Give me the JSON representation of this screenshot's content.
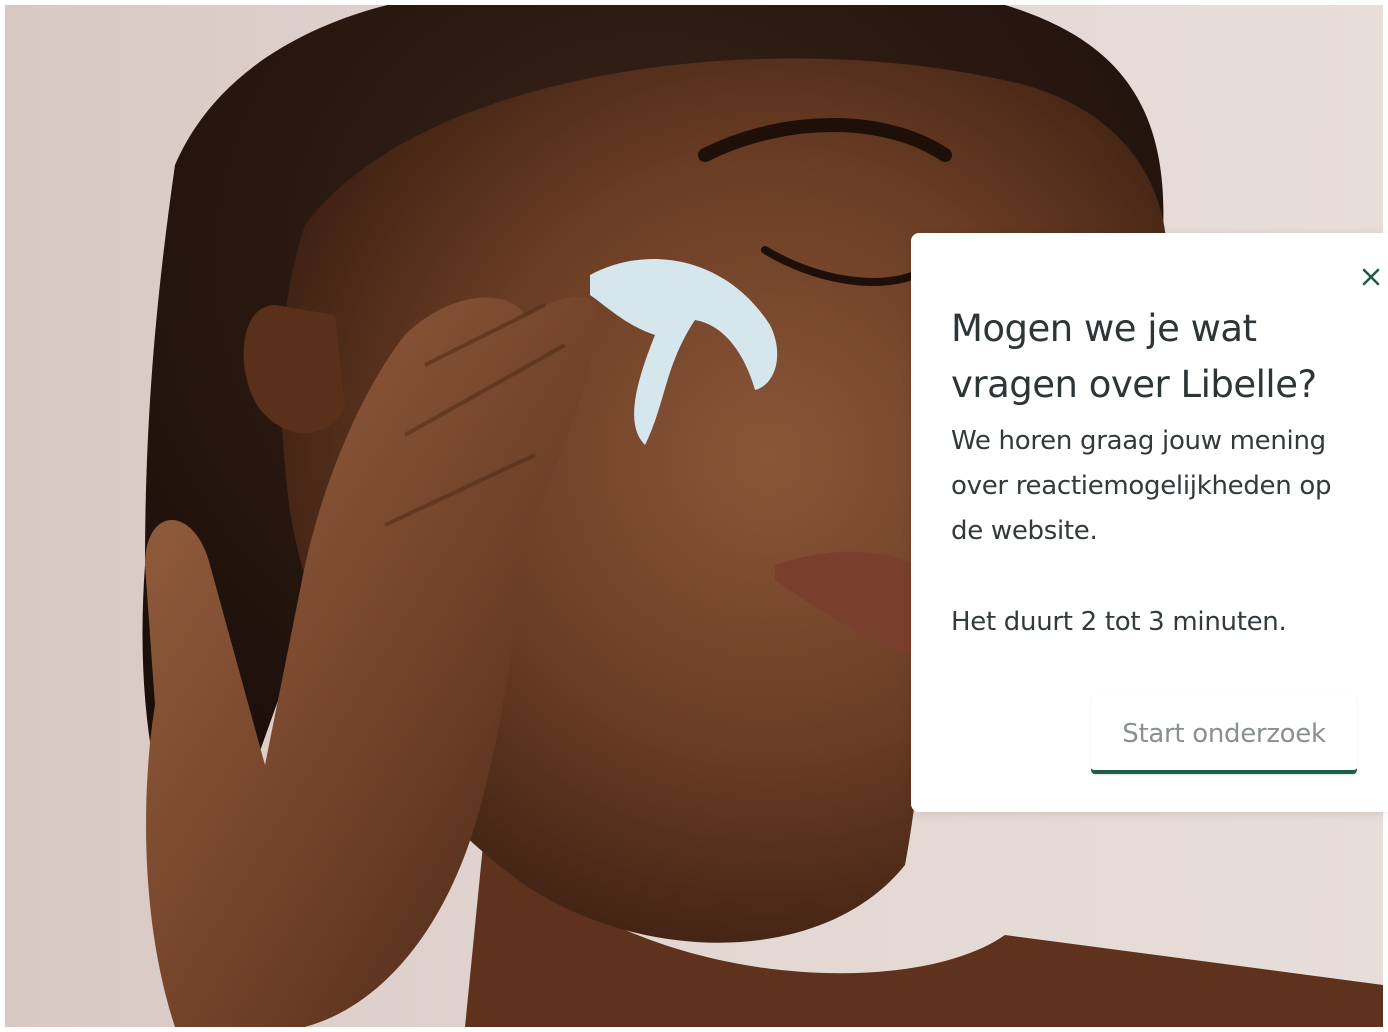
{
  "survey": {
    "title": "Mogen we je wat vragen over Libelle?",
    "body": "We horen graag jouw mening over reactiemogelijkheden op de website.",
    "duration": "Het duurt 2 tot 3 minuten.",
    "start_label": "Start onderzoek",
    "close_icon": "close-icon"
  },
  "colors": {
    "accent": "#1f5c46",
    "text": "#2e3538",
    "button_text": "#8a8f91",
    "backdrop": "#e3d7d3"
  }
}
